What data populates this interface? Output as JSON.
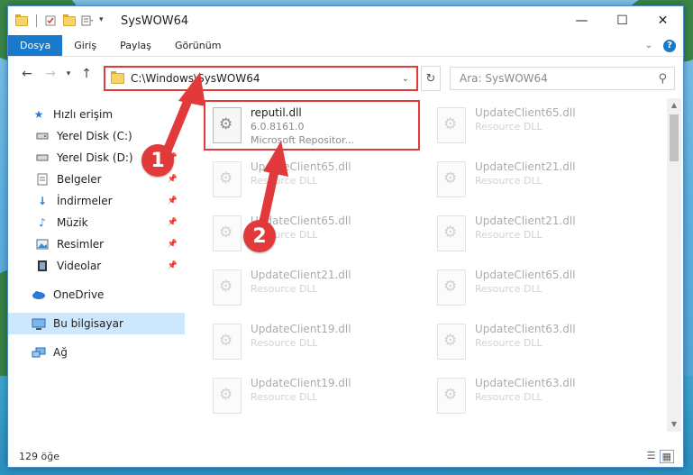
{
  "window": {
    "title": "SysWOW64"
  },
  "quick_access_icons": [
    "folder-icon",
    "properties-icon",
    "new-folder-icon",
    "customize-icon"
  ],
  "win_controls": {
    "minimize": "—",
    "maximize": "☐",
    "close": "✕"
  },
  "ribbon": {
    "tabs": [
      {
        "label": "Dosya",
        "active": true
      },
      {
        "label": "Giriş"
      },
      {
        "label": "Paylaş"
      },
      {
        "label": "Görünüm"
      }
    ],
    "help": "?"
  },
  "nav": {
    "back": "←",
    "forward": "→",
    "up": "↑",
    "address": "C:\\Windows\\SysWOW64",
    "search_placeholder": "Ara: SysWOW64"
  },
  "sidebar": {
    "items": [
      {
        "label": "Hızlı erişim",
        "icon": "star-icon"
      },
      {
        "label": "Yerel Disk (C:)",
        "icon": "drive-icon"
      },
      {
        "label": "Yerel Disk (D:)",
        "icon": "drive-icon"
      },
      {
        "label": "Belgeler",
        "icon": "documents-icon"
      },
      {
        "label": "İndirmeler",
        "icon": "download-icon"
      },
      {
        "label": "Müzik",
        "icon": "music-icon"
      },
      {
        "label": "Resimler",
        "icon": "pictures-icon"
      },
      {
        "label": "Videolar",
        "icon": "video-icon"
      },
      {
        "label": "OneDrive",
        "icon": "cloud-icon"
      },
      {
        "label": "Bu bilgisayar",
        "icon": "computer-icon"
      },
      {
        "label": "Ağ",
        "icon": "network-icon"
      }
    ]
  },
  "files": [
    {
      "name": "reputil.dll",
      "line2": "6.0.8161.0",
      "line3": "Microsoft Repositor..."
    },
    {
      "name": "UpdateClient65.dll",
      "desc": "Resource DLL"
    },
    {
      "name": "UpdateClient65.dll",
      "desc": "Resource DLL"
    },
    {
      "name": "UpdateClient21.dll",
      "desc": "Resource DLL"
    },
    {
      "name": "UpdateClient65.dll",
      "desc": "Resource DLL"
    },
    {
      "name": "UpdateClient21.dll",
      "desc": "Resource DLL"
    },
    {
      "name": "UpdateClient21.dll",
      "desc": "Resource DLL"
    },
    {
      "name": "UpdateClient65.dll",
      "desc": "Resource DLL"
    },
    {
      "name": "UpdateClient19.dll",
      "desc": "Resource DLL"
    },
    {
      "name": "UpdateClient63.dll",
      "desc": "Resource DLL"
    },
    {
      "name": "UpdateClient19.dll",
      "desc": "Resource DLL"
    },
    {
      "name": "UpdateClient63.dll",
      "desc": "Resource DLL"
    }
  ],
  "status": {
    "count": "129 öğe"
  },
  "callouts": {
    "one": "1",
    "two": "2"
  },
  "colors": {
    "accent": "#1979ca",
    "highlight": "#e23a3a",
    "selection": "#cce8ff"
  }
}
